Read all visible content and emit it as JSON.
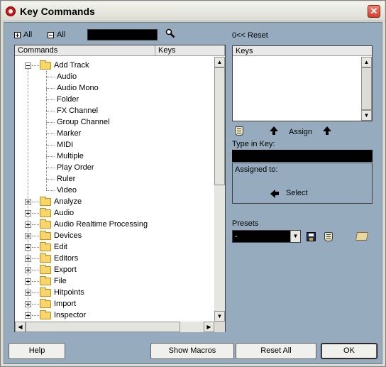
{
  "window": {
    "title": "Key Commands",
    "close_label": "✕"
  },
  "toolbar": {
    "expand_all": "All",
    "collapse_all": "All",
    "reset": "Reset",
    "reset_prefix": "0<<"
  },
  "tree": {
    "col_commands": "Commands",
    "col_keys": "Keys",
    "open_folder": {
      "label": "Add Track",
      "children": [
        "Audio",
        "Audio Mono",
        "Folder",
        "FX Channel",
        "Group Channel",
        "Marker",
        "MIDI",
        "Multiple",
        "Play Order",
        "Ruler",
        "Video"
      ]
    },
    "folders": [
      "Analyze",
      "Audio",
      "Audio Realtime Processing",
      "Devices",
      "Edit",
      "Editors",
      "Export",
      "File",
      "Hitpoints",
      "Import",
      "Inspector"
    ]
  },
  "keys_panel": {
    "header": "Keys",
    "assign": "Assign",
    "type_in_key": "Type in Key:",
    "assigned_to": "Assigned to:",
    "select": "Select"
  },
  "presets": {
    "label": "Presets",
    "selected": "-"
  },
  "buttons": {
    "help": "Help",
    "show_macros": "Show Macros",
    "reset_all": "Reset All",
    "ok": "OK"
  }
}
